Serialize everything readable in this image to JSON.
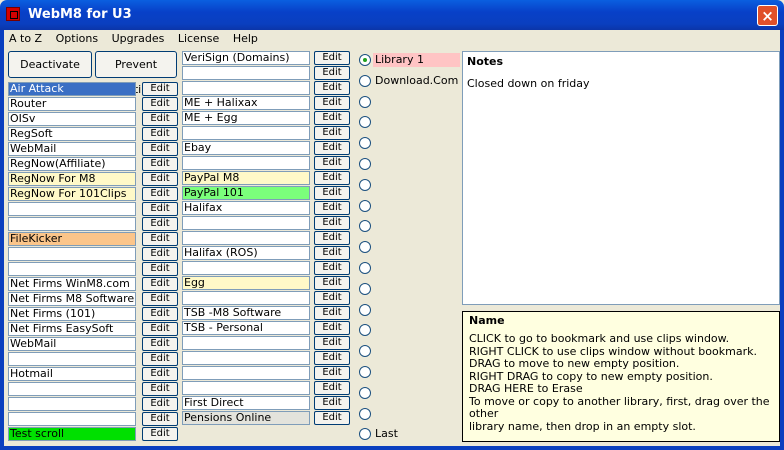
{
  "window": {
    "title": "WebM8 for U3",
    "close_label": "×"
  },
  "menu": [
    "A to Z",
    "Options",
    "Upgrades",
    "License",
    "Help"
  ],
  "buttons": {
    "deactivate": "Deactivate",
    "prevent_editing": "Prevent Editing"
  },
  "edit_label": "Edit",
  "colors": {
    "selected": "#3a6fc4",
    "yellow": "#fff9c8",
    "orange": "#fbc58a",
    "green": "#7bff7b",
    "bright_green": "#00e000",
    "pink": "#ffc4c4",
    "grey": "#e3e3dc"
  },
  "col1": [
    {
      "label": "Air Attack",
      "color": "selected"
    },
    {
      "label": "Router"
    },
    {
      "label": "OISv"
    },
    {
      "label": "RegSoft"
    },
    {
      "label": "WebMail"
    },
    {
      "label": "RegNow(Affiliate)"
    },
    {
      "label": "RegNow For M8",
      "color": "yellow"
    },
    {
      "label": "RegNow For 101Clips",
      "color": "yellow"
    },
    {
      "label": ""
    },
    {
      "label": ""
    },
    {
      "label": "FileKicker",
      "color": "orange"
    },
    {
      "label": ""
    },
    {
      "label": ""
    },
    {
      "label": "Net Firms  WinM8.com"
    },
    {
      "label": "Net Firms  M8 Software"
    },
    {
      "label": "Net Firms (101)"
    },
    {
      "label": "Net Firms  EasySoft"
    },
    {
      "label": "WebMail"
    },
    {
      "label": ""
    },
    {
      "label": "Hotmail"
    },
    {
      "label": ""
    },
    {
      "label": ""
    },
    {
      "label": ""
    },
    {
      "label": "Test scroll",
      "color": "bright_green"
    }
  ],
  "col2": [
    {
      "label": "VeriSign (Domains)"
    },
    {
      "label": ""
    },
    {
      "label": ""
    },
    {
      "label": "ME + Halixax"
    },
    {
      "label": "ME + Egg"
    },
    {
      "label": ""
    },
    {
      "label": "Ebay"
    },
    {
      "label": ""
    },
    {
      "label": "PayPal M8",
      "color": "yellow"
    },
    {
      "label": "PayPal 101",
      "color": "green"
    },
    {
      "label": "Halifax"
    },
    {
      "label": ""
    },
    {
      "label": ""
    },
    {
      "label": "Halifax (ROS)"
    },
    {
      "label": ""
    },
    {
      "label": "Egg",
      "color": "yellow"
    },
    {
      "label": ""
    },
    {
      "label": "TSB -M8 Software"
    },
    {
      "label": "TSB - Personal"
    },
    {
      "label": ""
    },
    {
      "label": ""
    },
    {
      "label": ""
    },
    {
      "label": ""
    },
    {
      "label": "First Direct"
    },
    {
      "label": "Pensions Online",
      "color": "grey"
    }
  ],
  "libraries": [
    {
      "label": "Library 1",
      "selected": true,
      "color": "pink"
    },
    {
      "label": "Download.Com"
    },
    {
      "label": ""
    },
    {
      "label": ""
    },
    {
      "label": ""
    },
    {
      "label": ""
    },
    {
      "label": ""
    },
    {
      "label": ""
    },
    {
      "label": ""
    },
    {
      "label": ""
    },
    {
      "label": ""
    },
    {
      "label": ""
    },
    {
      "label": ""
    },
    {
      "label": ""
    },
    {
      "label": ""
    },
    {
      "label": ""
    },
    {
      "label": ""
    },
    {
      "label": ""
    },
    {
      "label": "Last"
    }
  ],
  "notes": {
    "heading": "Notes",
    "body": "Closed down on friday"
  },
  "info": {
    "heading": "Name",
    "lines": [
      "CLICK to go to bookmark and use clips window.",
      "RIGHT CLICK to use clips window without bookmark.",
      "DRAG to move to new empty position.",
      "RIGHT DRAG to copy to new empty position.",
      "DRAG HERE to Erase",
      "To move or copy to another library, first, drag over the other",
      "library name, then drop in an empty slot."
    ]
  }
}
